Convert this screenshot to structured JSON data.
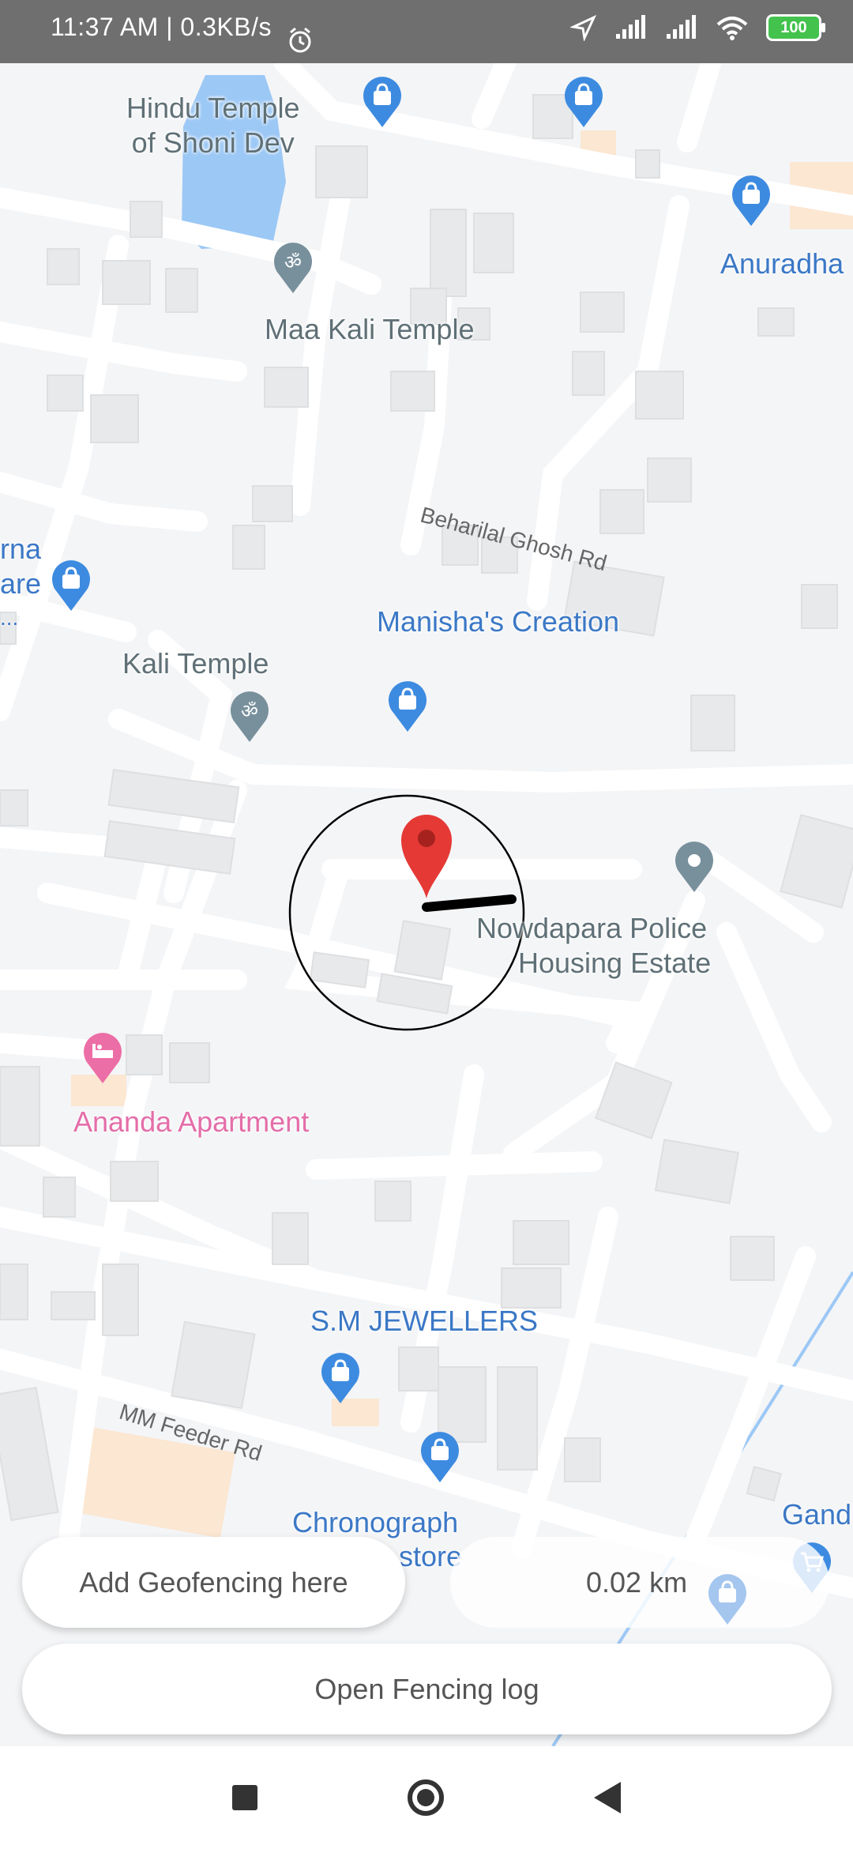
{
  "status_bar": {
    "time_text": "11:37 AM | 0.3KB/s",
    "battery_level": "100",
    "icons": [
      "alarm-icon",
      "location-arrow-icon",
      "signal-icon",
      "signal-icon",
      "wifi-icon",
      "battery-icon"
    ]
  },
  "map": {
    "places": {
      "hindu_temple": "Hindu Temple\nof Shoni Dev",
      "maa_kali": "Maa Kali Temple",
      "anuradha": "Anuradha",
      "rna_line1": "rna",
      "rna_line2": "are",
      "rna_line3": "...",
      "manisha": "Manisha's Creation",
      "kali_temple": "Kali Temple",
      "nowdapara_line1": "Nowdapara Police",
      "nowdapara_line2": "Housing Estate",
      "ananda": "Ananda Apartment",
      "sm_jewellers": "S.M JEWELLERS",
      "chronograph_line1": "Chronograph",
      "chronograph_line2": "store",
      "gand": "Gand"
    },
    "roads": {
      "beharilal": "Beharilal Ghosh Rd",
      "mm_feeder": "MM Feeder Rd"
    },
    "icon_names": [
      "shopping-bag-icon",
      "temple-icon",
      "map-pin-icon",
      "hotel-icon",
      "shopping-cart-icon"
    ]
  },
  "controls": {
    "add_geofence_label": "Add Geofencing here",
    "distance_value": "0.02 km",
    "open_log_label": "Open Fencing log"
  },
  "colors": {
    "blue_poi": "#3b78c6",
    "pink_poi": "#e46ea9",
    "marker_red": "#e53935",
    "water": "#9cc8f5"
  }
}
